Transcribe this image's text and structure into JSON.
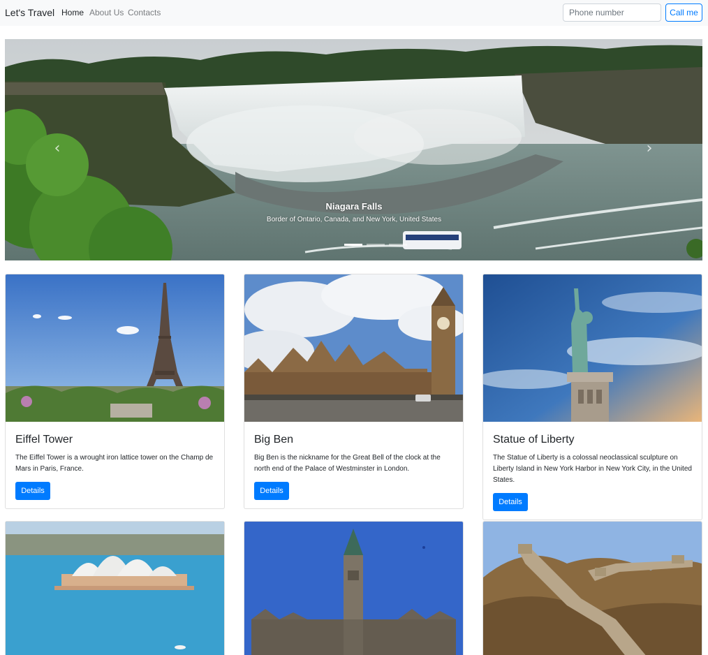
{
  "navbar": {
    "brand": "Let's Travel",
    "links": [
      {
        "label": "Home",
        "active": true
      },
      {
        "label": "About Us",
        "active": false
      },
      {
        "label": "Contacts",
        "active": false
      }
    ],
    "phone_placeholder": "Phone number",
    "call_label": "Call me"
  },
  "carousel": {
    "title": "Niagara Falls",
    "subtitle": "Border of Ontario, Canada, and New York, United States",
    "prev_icon": "chevron-left-icon",
    "next_icon": "chevron-right-icon",
    "slide_count": 3,
    "active_slide": 1
  },
  "cards": [
    {
      "title": "Eiffel Tower",
      "text": "The Eiffel Tower is a wrought iron lattice tower on the Champ de Mars in Paris, France.",
      "button": "Details"
    },
    {
      "title": "Big Ben",
      "text": "Big Ben is the nickname for the Great Bell of the clock at the north end of the Palace of Westminster in London.",
      "button": "Details"
    },
    {
      "title": "Statue of Liberty",
      "text": "The Statue of Liberty is a colossal neoclassical sculpture on Liberty Island in New York Harbor in New York City, in the United States.",
      "button": "Details"
    },
    {
      "title": "",
      "text": "",
      "button": ""
    },
    {
      "title": "",
      "text": "",
      "button": ""
    },
    {
      "title": "",
      "text": "",
      "button": ""
    }
  ],
  "colors": {
    "primary": "#007bff",
    "navbar_bg": "#f8f9fa"
  }
}
